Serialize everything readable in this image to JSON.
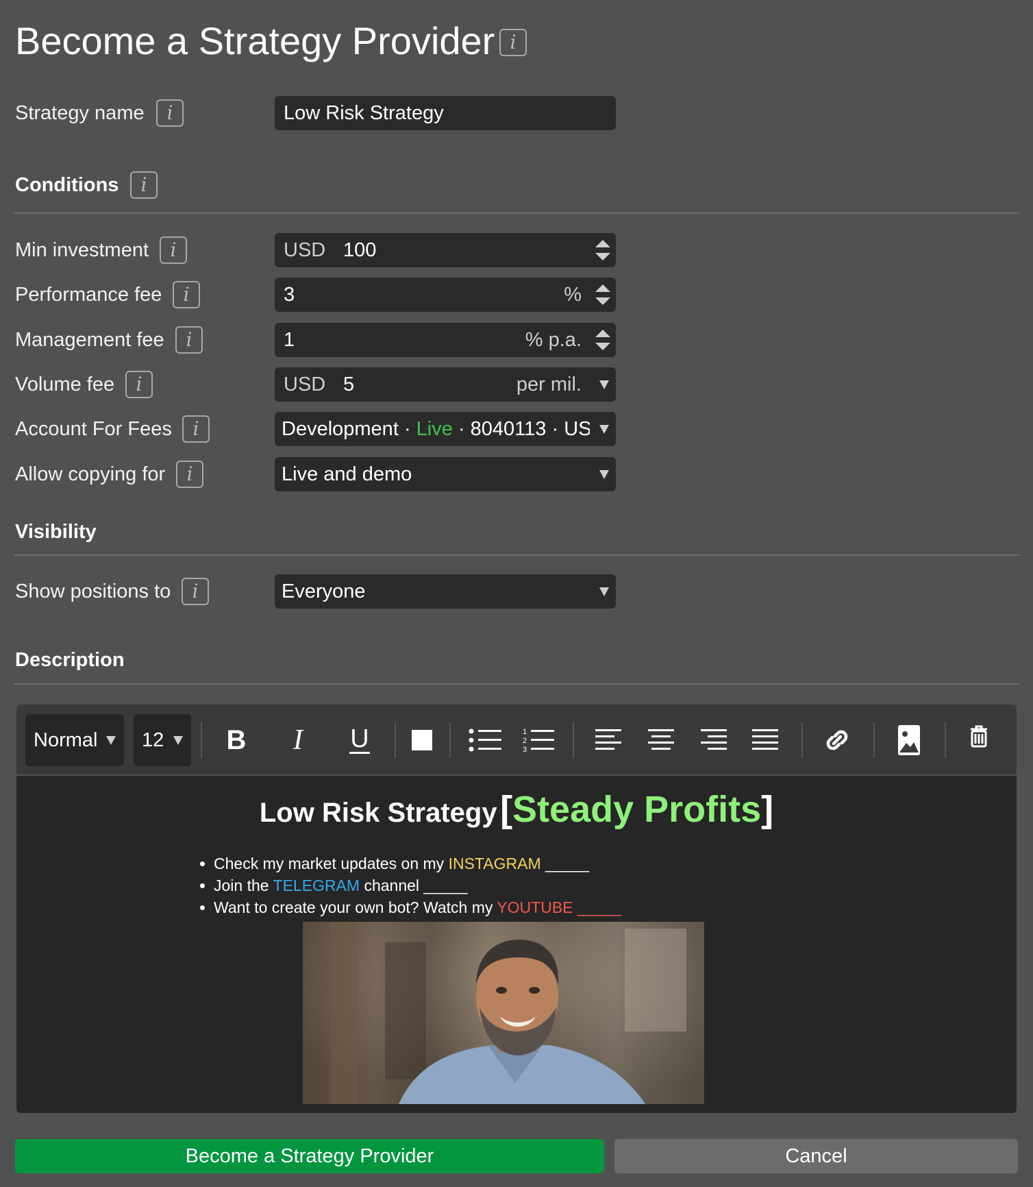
{
  "page": {
    "title": "Become a Strategy Provider"
  },
  "info_glyph": "i",
  "strategy_name": {
    "label": "Strategy name",
    "value": "Low Risk Strategy"
  },
  "conditions": {
    "heading": "Conditions",
    "min_investment": {
      "label": "Min investment",
      "currency": "USD",
      "value": "100"
    },
    "performance_fee": {
      "label": "Performance fee",
      "value": "3",
      "unit": "%"
    },
    "management_fee": {
      "label": "Management fee",
      "value": "1",
      "unit": "% p.a."
    },
    "volume_fee": {
      "label": "Volume fee",
      "currency": "USD",
      "value": "5",
      "unit": "per mil."
    },
    "account_for_fees": {
      "label": "Account For Fees",
      "name": "Development",
      "separator": "·",
      "type": "Live",
      "number": "8040113",
      "currency": "USD",
      "type_color": "#3ec44f"
    },
    "allow_copying_for": {
      "label": "Allow copying for",
      "value": "Live and demo"
    }
  },
  "visibility": {
    "heading": "Visibility",
    "show_positions_to": {
      "label": "Show positions to",
      "value": "Everyone"
    }
  },
  "description": {
    "heading": "Description",
    "toolbar": {
      "style_select": "Normal",
      "size_select": "12",
      "buttons": [
        "bold-icon",
        "italic-icon",
        "underline-icon",
        "text-color-icon",
        "bullet-list-icon",
        "numbered-list-icon",
        "align-left-icon",
        "align-center-icon",
        "align-right-icon",
        "align-justify-icon",
        "link-icon",
        "image-icon",
        "trash-icon"
      ],
      "text_color": "#ffffff"
    },
    "content": {
      "title_main": "Low Risk Strategy",
      "bracket_open": "[",
      "title_accent": "Steady Profits",
      "bracket_close": "]",
      "title_accent_color": "#8ff07a",
      "bullets": [
        {
          "before": "Check my market updates on my ",
          "highlight": "INSTAGRAM",
          "after": " _____",
          "color": "#f2d45c"
        },
        {
          "before": "Join the ",
          "highlight": "TELEGRAM",
          "after": " channel _____",
          "color": "#35a9ea"
        },
        {
          "before": "Want to create your own bot? Watch my ",
          "highlight": "YOUTUBE",
          "after": " _____",
          "color": "#f2594f"
        }
      ]
    }
  },
  "actions": {
    "submit_label": "Become a Strategy Provider",
    "cancel_label": "Cancel",
    "submit_color": "#04963f"
  }
}
